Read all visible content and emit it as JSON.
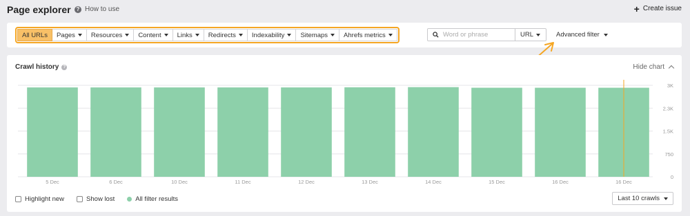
{
  "header": {
    "title": "Page explorer",
    "help_label": "How to use",
    "create_issue_label": "Create issue"
  },
  "filters": {
    "items": [
      {
        "label": "All URLs",
        "active": true,
        "dropdown": false
      },
      {
        "label": "Pages",
        "active": false,
        "dropdown": true
      },
      {
        "label": "Resources",
        "active": false,
        "dropdown": true
      },
      {
        "label": "Content",
        "active": false,
        "dropdown": true
      },
      {
        "label": "Links",
        "active": false,
        "dropdown": true
      },
      {
        "label": "Redirects",
        "active": false,
        "dropdown": true
      },
      {
        "label": "Indexability",
        "active": false,
        "dropdown": true
      },
      {
        "label": "Sitemaps",
        "active": false,
        "dropdown": true
      },
      {
        "label": "Ahrefs metrics",
        "active": false,
        "dropdown": true
      }
    ],
    "search_placeholder": "Word or phrase",
    "search_value": "",
    "search_scope": "URL",
    "advanced_filter_label": "Advanced filter",
    "highlight_color": "#f5a623"
  },
  "crawl_history": {
    "title": "Crawl history",
    "hide_chart_label": "Hide chart",
    "legend": {
      "highlight_new": "Highlight new",
      "show_lost": "Show lost",
      "all_filter_results": "All filter results"
    },
    "range_select": "Last 10 crawls"
  },
  "chart_data": {
    "type": "bar",
    "categories": [
      "5 Dec",
      "6 Dec",
      "10 Dec",
      "11 Dec",
      "12 Dec",
      "13 Dec",
      "14 Dec",
      "15 Dec",
      "16 Dec",
      "16 Dec"
    ],
    "values": [
      2930,
      2930,
      2930,
      2930,
      2930,
      2935,
      2940,
      2920,
      2920,
      2920
    ],
    "y_ticks": [
      {
        "value": 0,
        "label": "0"
      },
      {
        "value": 750,
        "label": "750"
      },
      {
        "value": 1500,
        "label": "1.5K"
      },
      {
        "value": 2250,
        "label": "2.3K"
      },
      {
        "value": 3000,
        "label": "3K"
      }
    ],
    "ylim": [
      0,
      3000
    ],
    "grid": true,
    "bar_color": "#8dd0aa",
    "marker_color": "#f5a623",
    "title": "Crawl history"
  }
}
